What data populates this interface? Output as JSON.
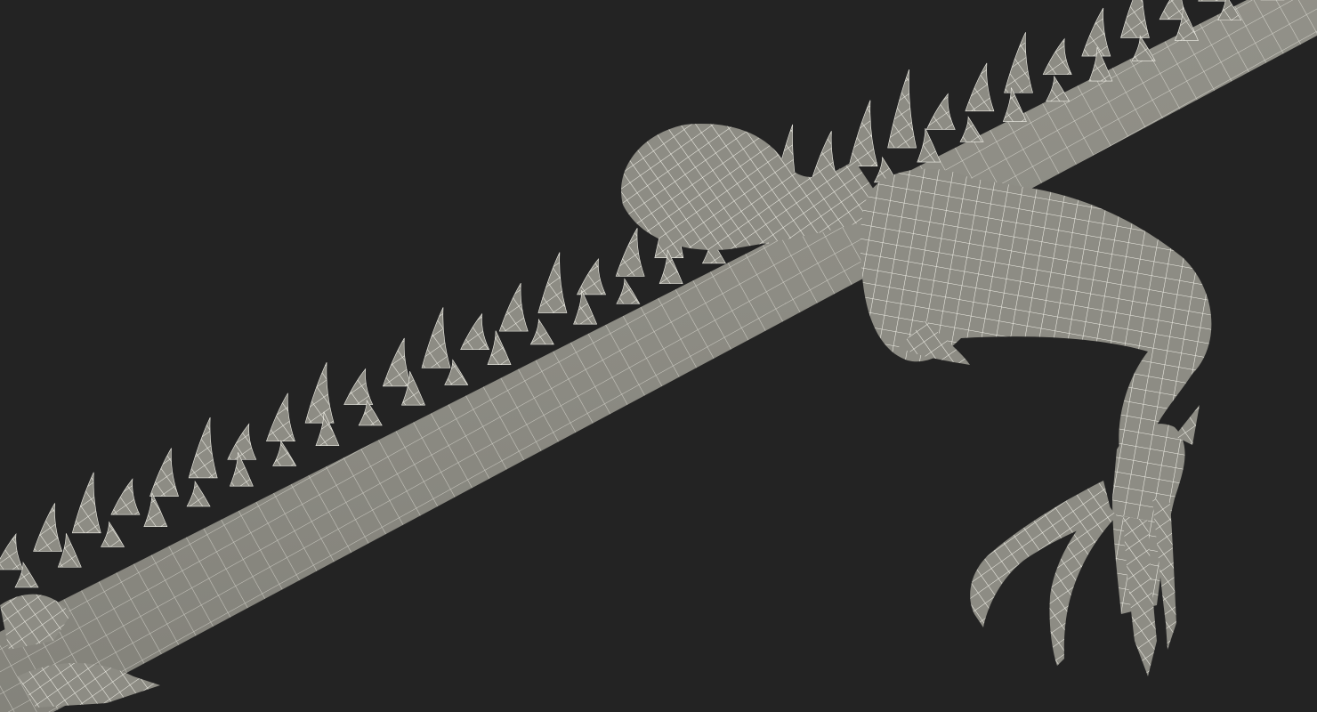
{
  "render": {
    "background_color": "#232323",
    "mesh_fill_color": "#8d8c84",
    "mesh_shade_color": "#6f6e67",
    "mesh_highlight_color": "#a7a69d",
    "wire_color": "#f2f1e9",
    "style": "wireframe-on-shaded"
  },
  "subject": {
    "icon": "lizard-tail-and-hind-leg-mesh"
  }
}
